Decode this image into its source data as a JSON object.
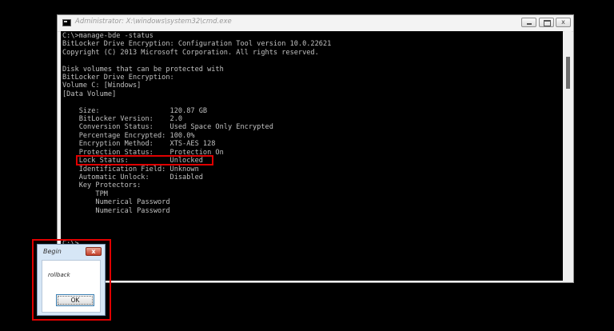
{
  "window": {
    "title": "Administrator: X:\\windows\\system32\\cmd.exe",
    "close_glyph": "x"
  },
  "console": {
    "text": "C:\\>manage-bde -status\nBitLocker Drive Encryption: Configuration Tool version 10.0.22621\nCopyright (C) 2013 Microsoft Corporation. All rights reserved.\n\nDisk volumes that can be protected with\nBitLocker Drive Encryption:\nVolume C: [Windows]\n[Data Volume]\n\n    Size:                 120.87 GB\n    BitLocker Version:    2.0\n    Conversion Status:    Used Space Only Encrypted\n    Percentage Encrypted: 100.0%\n    Encryption Method:    XTS-AES 128\n    Protection Status:    Protection On\n    Lock Status:          Unlocked\n    Identification Field: Unknown\n    Automatic Unlock:     Disabled\n    Key Protectors:\n        TPM\n        Numerical Password\n        Numerical Password\n\n\n\nC:\\>"
  },
  "dialog": {
    "title": "Begin",
    "message": "rollback",
    "ok_label": "OK",
    "close_glyph": "x"
  },
  "colors": {
    "highlight": "#e00000",
    "console_bg": "#000000",
    "console_fg": "#c0c0c0"
  }
}
